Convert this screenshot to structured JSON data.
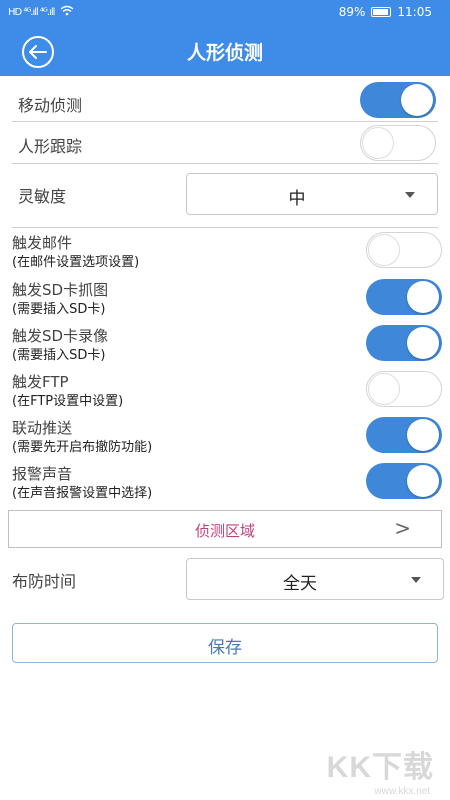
{
  "status_bar": {
    "signal_left": "HD ⁴ᴳ.ıll ⁴ᴳ.ıll",
    "battery_text": "89%",
    "battery_level": 0.89,
    "time": "11:05",
    "icons": [
      "hd-icon",
      "signal-icon",
      "wifi-icon",
      "battery-icon"
    ]
  },
  "header": {
    "title": "人形侦测",
    "back_icon": "back-arrow-icon"
  },
  "rows": {
    "motion_detect": {
      "label": "移动侦测",
      "on": true
    },
    "human_track": {
      "label": "人形跟踪",
      "on": false
    },
    "sensitivity": {
      "label": "灵敏度",
      "value": "中"
    },
    "trigger_email": {
      "label": "触发邮件",
      "sub": "(在邮件设置选项设置)",
      "on": false
    },
    "trigger_sd_snap": {
      "label": "触发SD卡抓图",
      "sub": "(需要插入SD卡)",
      "on": true
    },
    "trigger_sd_record": {
      "label": "触发SD卡录像",
      "sub": "(需要插入SD卡)",
      "on": true
    },
    "trigger_ftp": {
      "label": "触发FTP",
      "sub": "(在FTP设置中设置)",
      "on": false
    },
    "push": {
      "label": "联动推送",
      "sub": "(需要先开启布撤防功能)",
      "on": true
    },
    "alarm_sound": {
      "label": "报警声音",
      "sub": "(在声音报警设置中选择)",
      "on": true
    }
  },
  "detection_area": {
    "label": "侦测区域",
    "arrow": ">"
  },
  "arm_time": {
    "label": "布防时间",
    "value": "全天"
  },
  "save_label": "保存",
  "watermark": {
    "text": "KK下载",
    "url": "www.kkx.net"
  },
  "colors": {
    "primary": "#3f8ce8",
    "toggle_on": "#3f87d8",
    "accent_text": "#c0407a"
  }
}
